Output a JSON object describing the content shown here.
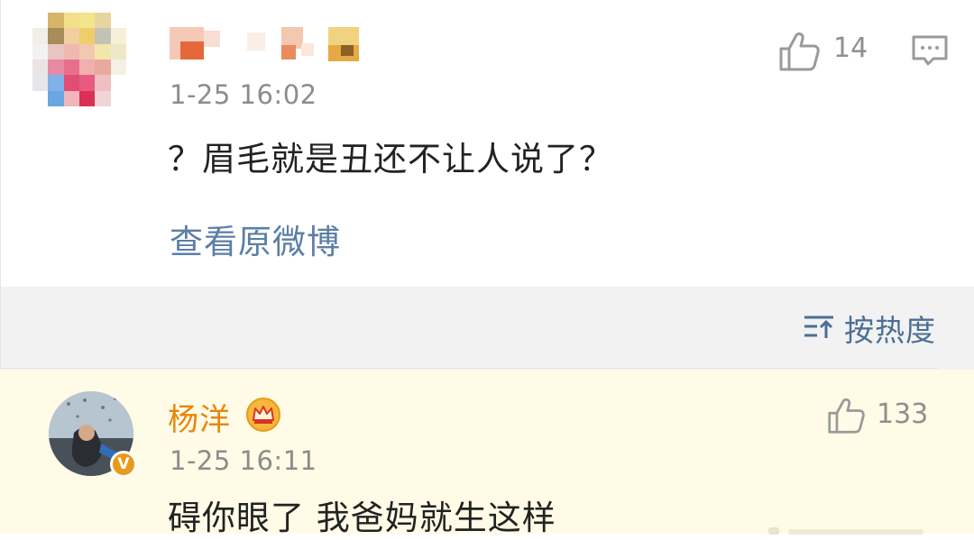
{
  "comment1": {
    "time": "1-25 16:02",
    "text": "？眉毛就是丑还不让人说了？",
    "like_count": "14",
    "view_original_label": "查看原微博",
    "like_icon": "thumbs-up-icon",
    "reply_icon": "comment-icon"
  },
  "sort": {
    "label": "按热度",
    "icon": "sort-icon"
  },
  "comment2": {
    "username": "杨洋",
    "badge": "crown-icon",
    "verified_badge": "V",
    "time": "1-25 16:11",
    "text": "碍你眼了 我爸妈就生这样",
    "like_count": "133",
    "like_icon": "thumbs-up-icon"
  },
  "colors": {
    "link": "#5b7fa6",
    "username": "#e8850f",
    "highlight_bg": "#fffbe6",
    "sort_bg": "#f2f2f2"
  }
}
